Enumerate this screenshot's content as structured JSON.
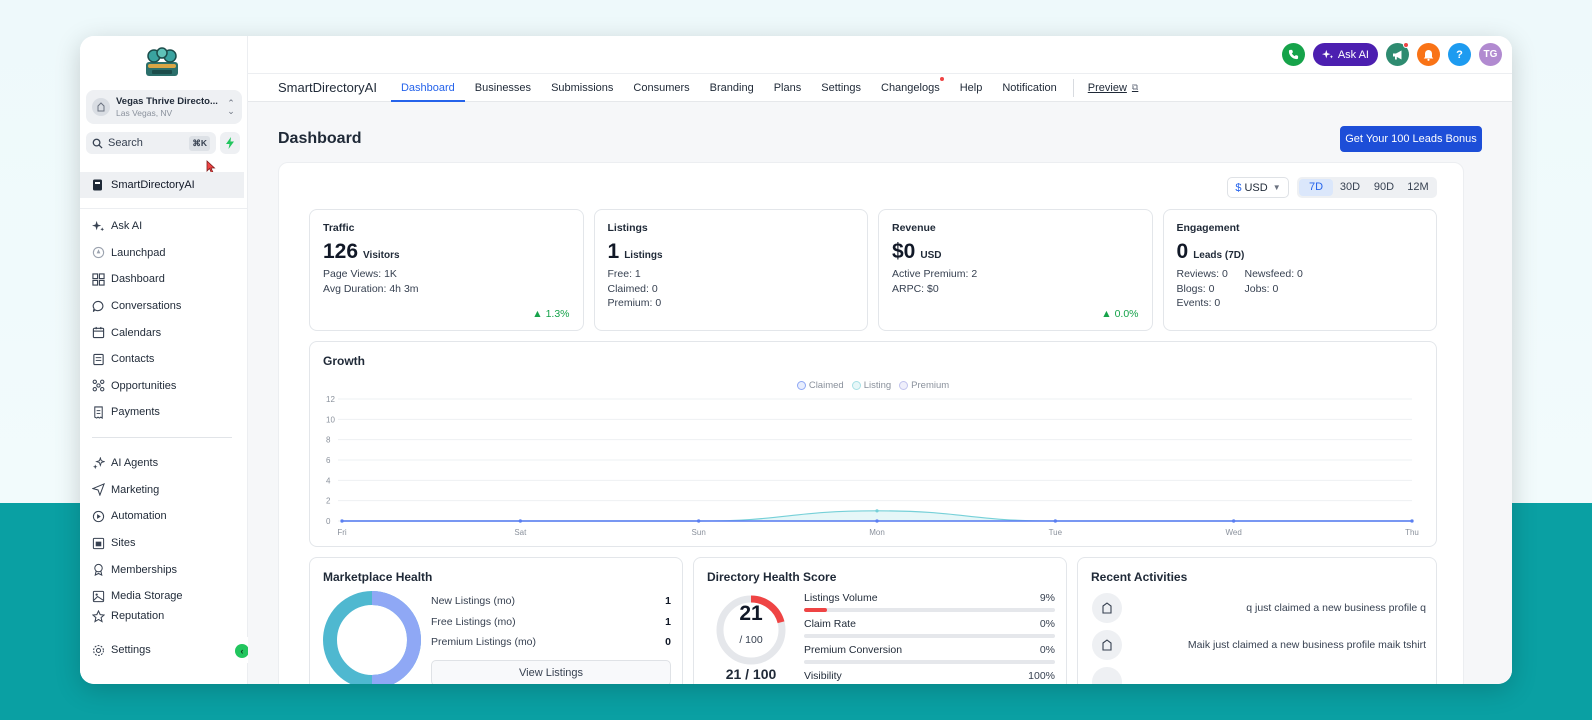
{
  "sidebar": {
    "location_name": "Vegas Thrive Directo...",
    "location_sub": "Las Vegas, NV",
    "search_label": "Search",
    "search_shortcut": "⌘K",
    "agency_item": "SmartDirectoryAI",
    "group1": [
      {
        "label": "Ask AI",
        "icon": "sparkle-icon"
      },
      {
        "label": "Launchpad",
        "icon": "rocket-icon"
      },
      {
        "label": "Dashboard",
        "icon": "grid-icon"
      },
      {
        "label": "Conversations",
        "icon": "chat-icon"
      },
      {
        "label": "Calendars",
        "icon": "calendar-icon"
      },
      {
        "label": "Contacts",
        "icon": "contacts-icon"
      },
      {
        "label": "Opportunities",
        "icon": "opportunities-icon"
      },
      {
        "label": "Payments",
        "icon": "receipt-icon"
      }
    ],
    "group2": [
      {
        "label": "AI Agents",
        "icon": "ai-agents-icon"
      },
      {
        "label": "Marketing",
        "icon": "send-icon"
      },
      {
        "label": "Automation",
        "icon": "automation-icon"
      },
      {
        "label": "Sites",
        "icon": "sites-icon"
      },
      {
        "label": "Memberships",
        "icon": "award-icon"
      },
      {
        "label": "Media Storage",
        "icon": "image-icon"
      },
      {
        "label": "Reputation",
        "icon": "star-icon"
      }
    ],
    "settings_label": "Settings"
  },
  "topbar": {
    "ask_ai": "Ask AI",
    "help": "?",
    "avatar": "TG"
  },
  "subnav": {
    "brand": "SmartDirectoryAI",
    "tabs": [
      "Dashboard",
      "Businesses",
      "Submissions",
      "Consumers",
      "Branding",
      "Plans",
      "Settings",
      "Changelogs",
      "Help",
      "Notification"
    ],
    "preview": "Preview"
  },
  "page": {
    "title": "Dashboard",
    "bonus_button": "Get Your 100 Leads Bonus",
    "currency_symbol": "$",
    "currency": "USD",
    "ranges": [
      "7D",
      "30D",
      "90D",
      "12M"
    ]
  },
  "cards": {
    "traffic": {
      "title": "Traffic",
      "num": "126",
      "unit": "Visitors",
      "lines": [
        "Page Views: 1K",
        "Avg Duration: 4h 3m"
      ],
      "trend": "1.3%"
    },
    "listings": {
      "title": "Listings",
      "num": "1",
      "unit": "Listings",
      "lines": [
        "Free: 1",
        "Claimed: 0",
        "Premium: 0"
      ]
    },
    "revenue": {
      "title": "Revenue",
      "num": "$0",
      "unit": "USD",
      "lines": [
        "Active Premium: 2",
        "ARPC: $0"
      ],
      "trend": "0.0%"
    },
    "engagement": {
      "title": "Engagement",
      "num": "0",
      "unit": "Leads (7D)",
      "cells": [
        "Reviews: 0",
        "Newsfeed: 0",
        "Blogs: 0",
        "Jobs: 0",
        "Events: 0"
      ]
    }
  },
  "growth": {
    "title": "Growth"
  },
  "chart_data": {
    "type": "line",
    "title": "Growth",
    "categories": [
      "Fri",
      "Sat",
      "Sun",
      "Mon",
      "Tue",
      "Wed",
      "Thu"
    ],
    "series": [
      {
        "name": "Claimed",
        "values": [
          0,
          0,
          0,
          0,
          0,
          0,
          0
        ],
        "color": "#5b7ff2"
      },
      {
        "name": "Listing",
        "values": [
          0,
          0,
          0,
          1,
          0,
          0,
          0
        ],
        "color": "#76d0d8"
      },
      {
        "name": "Premium",
        "values": [
          0,
          0,
          0,
          0,
          0,
          0,
          0
        ],
        "color": "#a7a9e8"
      }
    ],
    "ylim": [
      0,
      12
    ],
    "yticks": [
      0,
      2,
      4,
      6,
      8,
      10,
      12
    ],
    "grid": true,
    "legend": "top-center"
  },
  "marketplace": {
    "title": "Marketplace Health",
    "rows": [
      {
        "label": "New Listings (mo)",
        "value": "1"
      },
      {
        "label": "Free Listings (mo)",
        "value": "1"
      },
      {
        "label": "Premium Listings (mo)",
        "value": "0"
      }
    ],
    "button": "View Listings",
    "donut_colors": [
      "#8fa8f5",
      "#4fb8d0"
    ]
  },
  "health": {
    "title": "Directory Health Score",
    "score": "21",
    "denominator": "/ 100",
    "total": "21 / 100",
    "score_fraction": 0.21,
    "metrics": [
      {
        "label": "Listings Volume",
        "pct": "9%",
        "fill": 0.09
      },
      {
        "label": "Claim Rate",
        "pct": "0%",
        "fill": 0
      },
      {
        "label": "Premium Conversion",
        "pct": "0%",
        "fill": 0
      },
      {
        "label": "Visibility",
        "pct": "100%",
        "fill": 1
      }
    ]
  },
  "activities": {
    "title": "Recent Activities",
    "items": [
      "q just claimed a new business profile q",
      "Maik just claimed a new business profile maik tshirt"
    ]
  }
}
